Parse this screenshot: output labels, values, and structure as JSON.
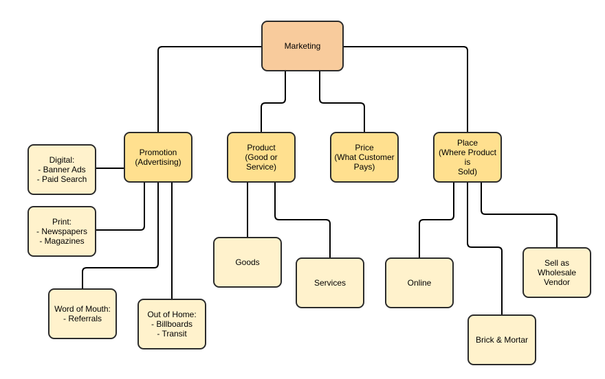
{
  "colors": {
    "root": "#f8cb9c",
    "category": "#ffe08f",
    "leaf": "#fff2cc",
    "stroke": "#2b2b2b"
  },
  "nodes": {
    "marketing": "Marketing",
    "promotion": "Promotion\n(Advertising)",
    "product": "Product\n(Good or Service)",
    "price": "Price\n(What Customer\nPays)",
    "place": "Place\n(Where Product is\nSold)",
    "digital": "Digital:\n- Banner Ads\n- Paid Search",
    "print": "Print:\n- Newspapers\n- Magazines",
    "word_of_mouth": "Word of Mouth:\n- Referrals",
    "out_of_home": "Out of Home:\n- Billboards\n- Transit",
    "goods": "Goods",
    "services": "Services",
    "online": "Online",
    "brick_mortar": "Brick & Mortar",
    "wholesale": "Sell as Wholesale\nVendor"
  }
}
